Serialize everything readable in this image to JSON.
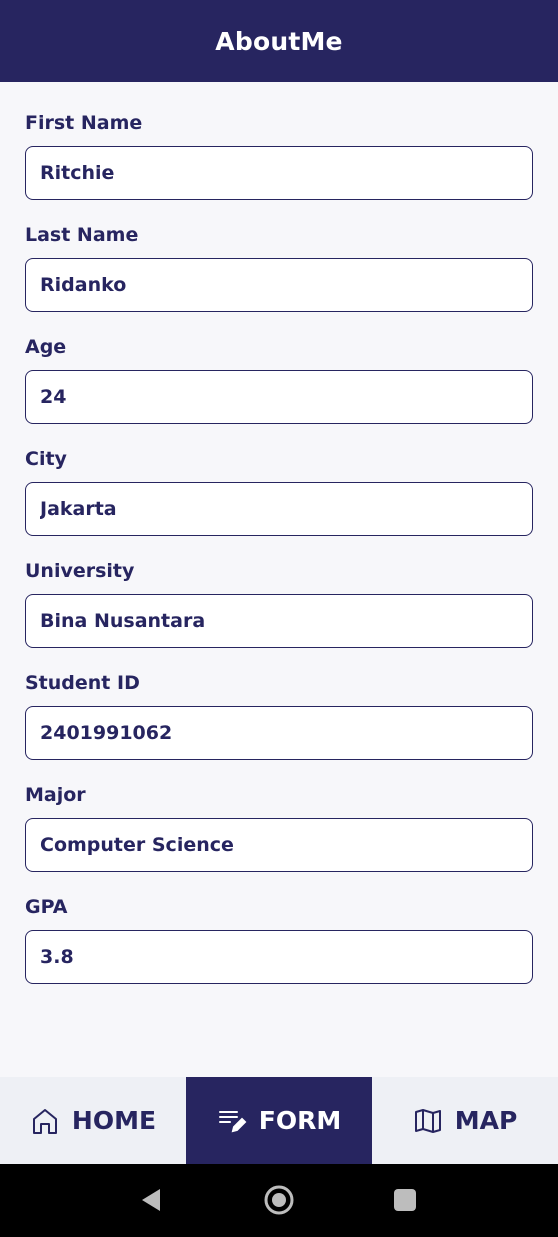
{
  "appbar": {
    "title": "AboutMe"
  },
  "form": {
    "fields": [
      {
        "label": "First Name",
        "value": "Ritchie"
      },
      {
        "label": "Last Name",
        "value": "Ridanko"
      },
      {
        "label": "Age",
        "value": "24"
      },
      {
        "label": "City",
        "value": "Jakarta"
      },
      {
        "label": "University",
        "value": "Bina Nusantara"
      },
      {
        "label": "Student ID",
        "value": "2401991062"
      },
      {
        "label": "Major",
        "value": "Computer Science"
      },
      {
        "label": "GPA",
        "value": "3.8"
      }
    ]
  },
  "bottom_nav": {
    "items": [
      {
        "label": "HOME",
        "icon": "home-icon",
        "active": false
      },
      {
        "label": "FORM",
        "icon": "form-edit-icon",
        "active": true
      },
      {
        "label": "MAP",
        "icon": "map-icon",
        "active": false
      }
    ]
  },
  "system_nav": {
    "icons": [
      "back-triangle-icon",
      "home-circle-icon",
      "recents-square-icon"
    ]
  },
  "colors": {
    "primary": "#272560",
    "background": "#f7f7fa",
    "nav_background": "#eef0f5",
    "system_bar": "#000000"
  }
}
